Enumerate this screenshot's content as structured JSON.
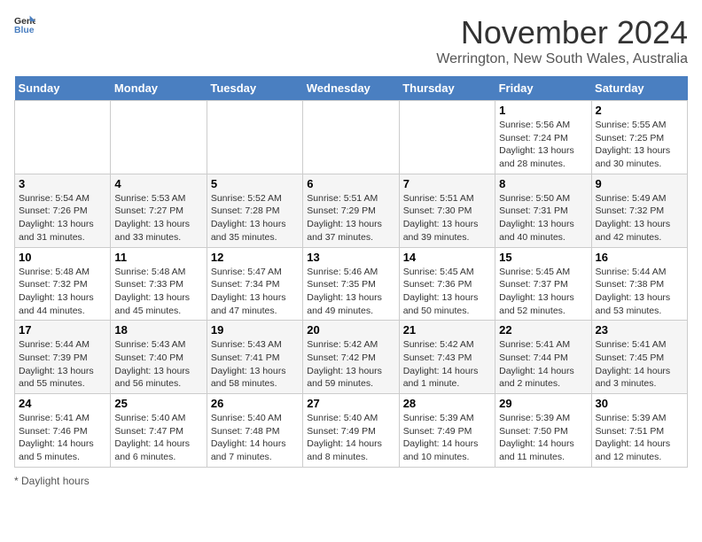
{
  "logo": {
    "text_general": "General",
    "text_blue": "Blue"
  },
  "title": "November 2024",
  "subtitle": "Werrington, New South Wales, Australia",
  "days_of_week": [
    "Sunday",
    "Monday",
    "Tuesday",
    "Wednesday",
    "Thursday",
    "Friday",
    "Saturday"
  ],
  "weeks": [
    [
      {
        "day": "",
        "info": ""
      },
      {
        "day": "",
        "info": ""
      },
      {
        "day": "",
        "info": ""
      },
      {
        "day": "",
        "info": ""
      },
      {
        "day": "",
        "info": ""
      },
      {
        "day": "1",
        "info": "Sunrise: 5:56 AM\nSunset: 7:24 PM\nDaylight: 13 hours and 28 minutes."
      },
      {
        "day": "2",
        "info": "Sunrise: 5:55 AM\nSunset: 7:25 PM\nDaylight: 13 hours and 30 minutes."
      }
    ],
    [
      {
        "day": "3",
        "info": "Sunrise: 5:54 AM\nSunset: 7:26 PM\nDaylight: 13 hours and 31 minutes."
      },
      {
        "day": "4",
        "info": "Sunrise: 5:53 AM\nSunset: 7:27 PM\nDaylight: 13 hours and 33 minutes."
      },
      {
        "day": "5",
        "info": "Sunrise: 5:52 AM\nSunset: 7:28 PM\nDaylight: 13 hours and 35 minutes."
      },
      {
        "day": "6",
        "info": "Sunrise: 5:51 AM\nSunset: 7:29 PM\nDaylight: 13 hours and 37 minutes."
      },
      {
        "day": "7",
        "info": "Sunrise: 5:51 AM\nSunset: 7:30 PM\nDaylight: 13 hours and 39 minutes."
      },
      {
        "day": "8",
        "info": "Sunrise: 5:50 AM\nSunset: 7:31 PM\nDaylight: 13 hours and 40 minutes."
      },
      {
        "day": "9",
        "info": "Sunrise: 5:49 AM\nSunset: 7:32 PM\nDaylight: 13 hours and 42 minutes."
      }
    ],
    [
      {
        "day": "10",
        "info": "Sunrise: 5:48 AM\nSunset: 7:32 PM\nDaylight: 13 hours and 44 minutes."
      },
      {
        "day": "11",
        "info": "Sunrise: 5:48 AM\nSunset: 7:33 PM\nDaylight: 13 hours and 45 minutes."
      },
      {
        "day": "12",
        "info": "Sunrise: 5:47 AM\nSunset: 7:34 PM\nDaylight: 13 hours and 47 minutes."
      },
      {
        "day": "13",
        "info": "Sunrise: 5:46 AM\nSunset: 7:35 PM\nDaylight: 13 hours and 49 minutes."
      },
      {
        "day": "14",
        "info": "Sunrise: 5:45 AM\nSunset: 7:36 PM\nDaylight: 13 hours and 50 minutes."
      },
      {
        "day": "15",
        "info": "Sunrise: 5:45 AM\nSunset: 7:37 PM\nDaylight: 13 hours and 52 minutes."
      },
      {
        "day": "16",
        "info": "Sunrise: 5:44 AM\nSunset: 7:38 PM\nDaylight: 13 hours and 53 minutes."
      }
    ],
    [
      {
        "day": "17",
        "info": "Sunrise: 5:44 AM\nSunset: 7:39 PM\nDaylight: 13 hours and 55 minutes."
      },
      {
        "day": "18",
        "info": "Sunrise: 5:43 AM\nSunset: 7:40 PM\nDaylight: 13 hours and 56 minutes."
      },
      {
        "day": "19",
        "info": "Sunrise: 5:43 AM\nSunset: 7:41 PM\nDaylight: 13 hours and 58 minutes."
      },
      {
        "day": "20",
        "info": "Sunrise: 5:42 AM\nSunset: 7:42 PM\nDaylight: 13 hours and 59 minutes."
      },
      {
        "day": "21",
        "info": "Sunrise: 5:42 AM\nSunset: 7:43 PM\nDaylight: 14 hours and 1 minute."
      },
      {
        "day": "22",
        "info": "Sunrise: 5:41 AM\nSunset: 7:44 PM\nDaylight: 14 hours and 2 minutes."
      },
      {
        "day": "23",
        "info": "Sunrise: 5:41 AM\nSunset: 7:45 PM\nDaylight: 14 hours and 3 minutes."
      }
    ],
    [
      {
        "day": "24",
        "info": "Sunrise: 5:41 AM\nSunset: 7:46 PM\nDaylight: 14 hours and 5 minutes."
      },
      {
        "day": "25",
        "info": "Sunrise: 5:40 AM\nSunset: 7:47 PM\nDaylight: 14 hours and 6 minutes."
      },
      {
        "day": "26",
        "info": "Sunrise: 5:40 AM\nSunset: 7:48 PM\nDaylight: 14 hours and 7 minutes."
      },
      {
        "day": "27",
        "info": "Sunrise: 5:40 AM\nSunset: 7:49 PM\nDaylight: 14 hours and 8 minutes."
      },
      {
        "day": "28",
        "info": "Sunrise: 5:39 AM\nSunset: 7:49 PM\nDaylight: 14 hours and 10 minutes."
      },
      {
        "day": "29",
        "info": "Sunrise: 5:39 AM\nSunset: 7:50 PM\nDaylight: 14 hours and 11 minutes."
      },
      {
        "day": "30",
        "info": "Sunrise: 5:39 AM\nSunset: 7:51 PM\nDaylight: 14 hours and 12 minutes."
      }
    ]
  ],
  "footer": "Daylight hours"
}
